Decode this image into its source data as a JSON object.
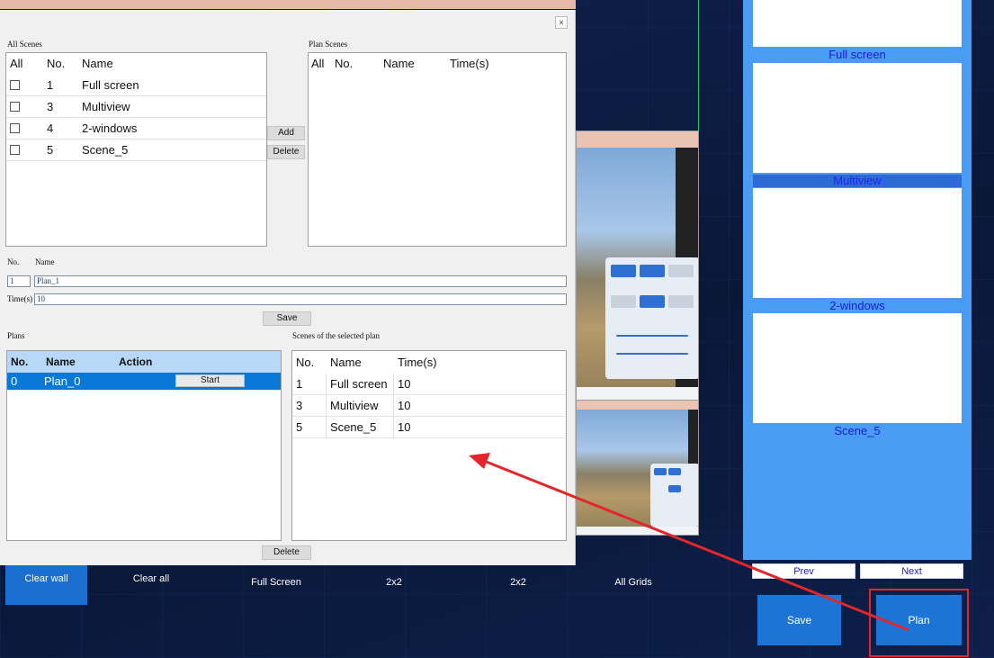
{
  "dialog": {
    "close_label": "×",
    "all_scenes": {
      "title": "All Scenes",
      "columns": [
        "All",
        "No.",
        "Name"
      ],
      "rows": [
        {
          "no": "1",
          "name": "Full screen"
        },
        {
          "no": "3",
          "name": "Multiview"
        },
        {
          "no": "4",
          "name": "2-windows"
        },
        {
          "no": "5",
          "name": "Scene_5"
        }
      ]
    },
    "plan_scenes": {
      "title": "Plan Scenes",
      "columns": [
        "All",
        "No.",
        "Name",
        "Time(s)"
      ]
    },
    "add_label": "Add",
    "delete_label": "Delete",
    "form": {
      "no_label": "No.",
      "name_label": "Name",
      "no_value": "1",
      "name_value": "Plan_1",
      "time_label": "Time(s)",
      "time_value": "10",
      "save_label": "Save"
    },
    "plans": {
      "title": "Plans",
      "columns": [
        "No.",
        "Name",
        "Action"
      ],
      "rows": [
        {
          "no": "0",
          "name": "Plan_0",
          "action": "Start"
        }
      ]
    },
    "selected_plan_scenes": {
      "title": "Scenes of the selected plan",
      "columns": [
        "No.",
        "Name",
        "Time(s)"
      ],
      "rows": [
        {
          "no": "1",
          "name": "Full screen",
          "time": "10"
        },
        {
          "no": "3",
          "name": "Multiview",
          "time": "10"
        },
        {
          "no": "5",
          "name": "Scene_5",
          "time": "10"
        }
      ]
    },
    "bottom_delete_label": "Delete"
  },
  "toolbar": {
    "clear_wall": "Clear wall",
    "clear_all": "Clear all",
    "full_screen": "Full Screen",
    "grid_2x2_a": "2x2",
    "grid_2x2_b": "2x2",
    "all_grids": "All Grids"
  },
  "scene_panel": {
    "scenes": [
      {
        "label": "Full screen",
        "selected": false
      },
      {
        "label": "Multiview",
        "selected": true
      },
      {
        "label": "2-windows",
        "selected": false
      },
      {
        "label": "Scene_5",
        "selected": false
      }
    ],
    "prev_label": "Prev",
    "next_label": "Next",
    "save_label": "Save",
    "plan_label": "Plan"
  },
  "colors": {
    "panel_bg": "#4a9cf3",
    "accent_blue": "#1c75d6",
    "selection_blue": "#0a78d7",
    "highlight_red": "#e3262b",
    "scene_label": "#1a1ad8"
  }
}
